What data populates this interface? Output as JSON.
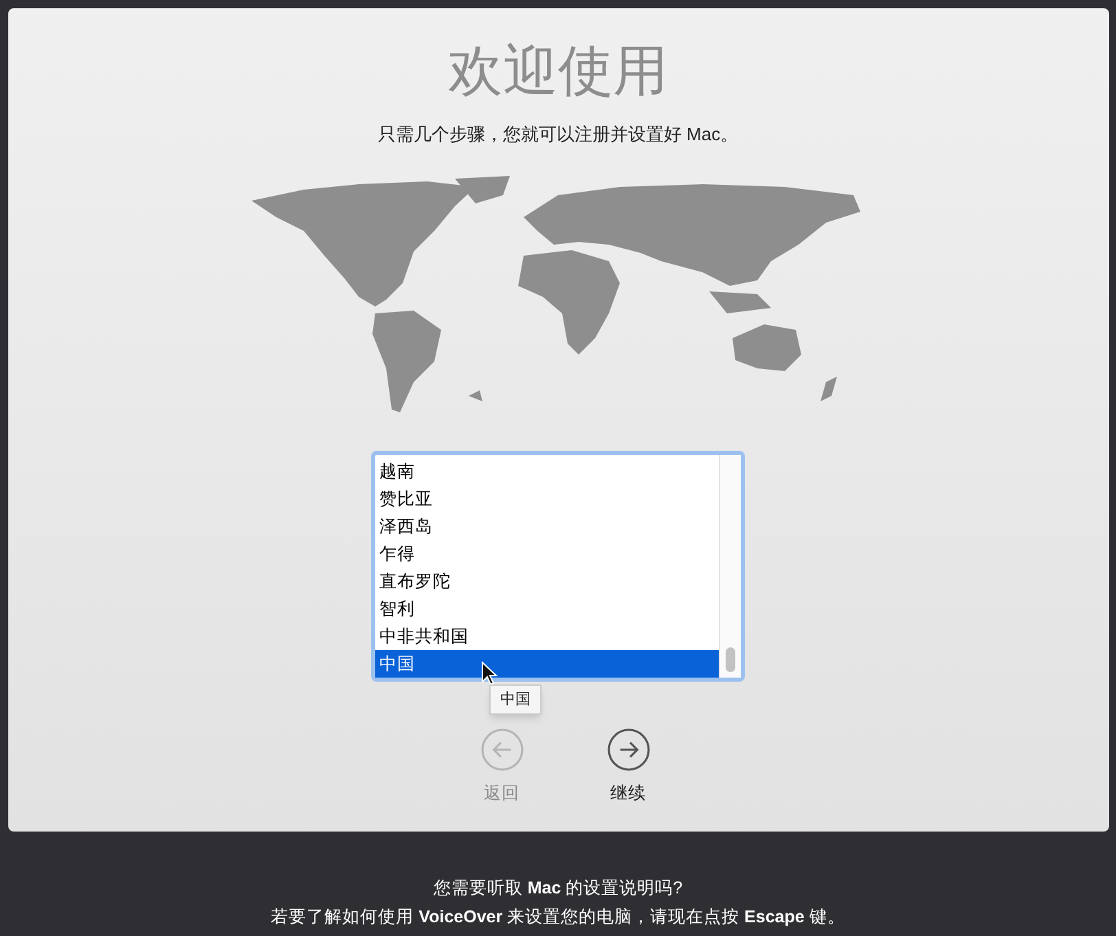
{
  "title": "欢迎使用",
  "subtitle": "只需几个步骤，您就可以注册并设置好 Mac。",
  "countries": [
    {
      "label": "越南",
      "selected": false
    },
    {
      "label": "赞比亚",
      "selected": false
    },
    {
      "label": "泽西岛",
      "selected": false
    },
    {
      "label": "乍得",
      "selected": false
    },
    {
      "label": "直布罗陀",
      "selected": false
    },
    {
      "label": "智利",
      "selected": false
    },
    {
      "label": "中非共和国",
      "selected": false
    },
    {
      "label": "中国",
      "selected": true
    }
  ],
  "tooltip": "中国",
  "buttons": [
    {
      "kind": "back",
      "label": "返回",
      "disabled": true
    },
    {
      "kind": "continue",
      "label": "继续",
      "disabled": false
    }
  ],
  "footer": [
    "您需要听取 **Mac** 的设置说明吗?",
    "若要了解如何使用 **VoiceOver** 来设置您的电脑，请现在点按 **Escape** 键。"
  ]
}
